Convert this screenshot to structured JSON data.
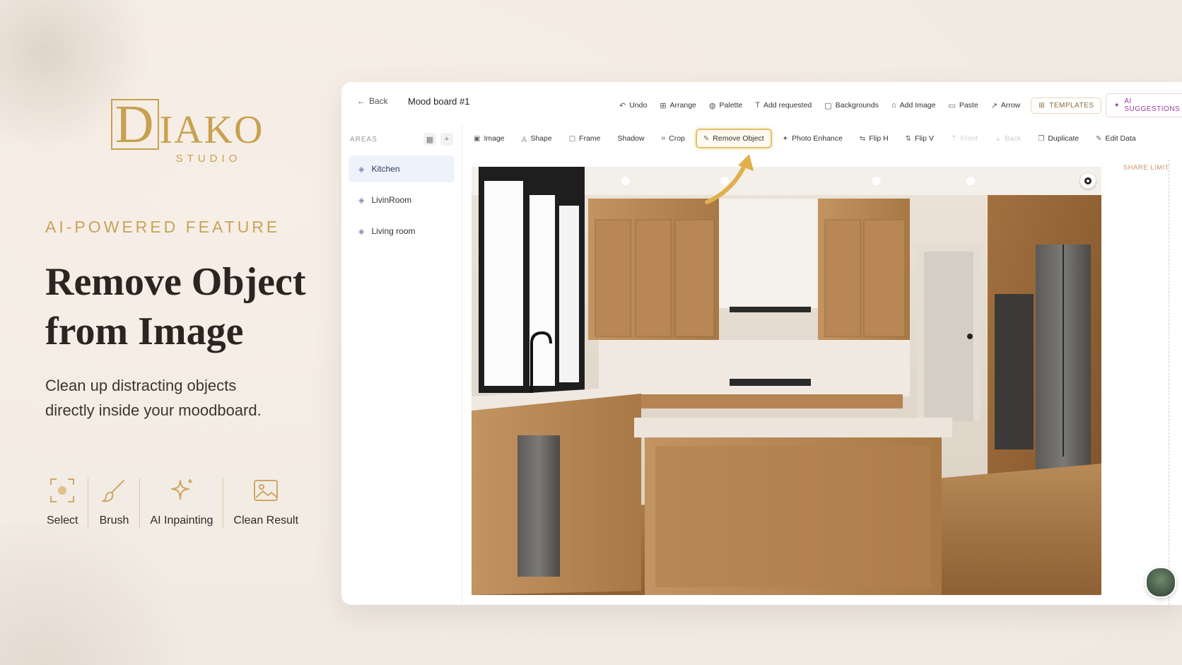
{
  "brand": {
    "name": "IAKO",
    "initial": "D",
    "sub": "STUDIO"
  },
  "hero": {
    "tag": "AI-POWERED FEATURE",
    "title_line1": "Remove Object",
    "title_line2": "from Image",
    "desc_line1": "Clean up distracting objects",
    "desc_line2": "directly inside your moodboard."
  },
  "steps": [
    {
      "label": "Select",
      "icon": "select-icon"
    },
    {
      "label": "Brush",
      "icon": "brush-icon"
    },
    {
      "label": "AI Inpainting",
      "icon": "sparkle-icon"
    },
    {
      "label": "Clean Result",
      "icon": "image-icon"
    }
  ],
  "app": {
    "back_label": "Back",
    "board_title": "Mood board #1",
    "top_actions": [
      {
        "label": "Undo",
        "glyph": "↶"
      },
      {
        "label": "Arrange",
        "glyph": "⊞"
      },
      {
        "label": "Palette",
        "glyph": "◍"
      },
      {
        "label": "Add requested",
        "glyph": "T"
      },
      {
        "label": "Backgrounds",
        "glyph": "▢"
      },
      {
        "label": "Add Image",
        "glyph": "⌂"
      },
      {
        "label": "Paste",
        "glyph": "▭"
      },
      {
        "label": "Arrow",
        "glyph": "↗"
      }
    ],
    "templates_label": "TEMPLATES",
    "ai_label": "AI SUGGESTIONS",
    "areas_title": "AREAS",
    "areas": [
      "Kitchen",
      "LivinRoom",
      "Living room"
    ],
    "toolbar": [
      {
        "label": "Image",
        "glyph": "▣"
      },
      {
        "label": "Shape",
        "glyph": "◬"
      },
      {
        "label": "Frame",
        "glyph": "▢"
      },
      {
        "label": "Shadow",
        "glyph": ""
      },
      {
        "label": "Crop",
        "glyph": "⌗"
      },
      {
        "label": "Remove Object",
        "glyph": "✎",
        "highlight": true
      },
      {
        "label": "Photo Enhance",
        "glyph": "✦"
      },
      {
        "label": "Flip H",
        "glyph": "⇆"
      },
      {
        "label": "Flip V",
        "glyph": "⇅"
      },
      {
        "label": "Front",
        "glyph": "⇡",
        "disabled": true
      },
      {
        "label": "Back",
        "glyph": "⇣",
        "disabled": true
      },
      {
        "label": "Duplicate",
        "glyph": "❐"
      },
      {
        "label": "Edit Data",
        "glyph": "✎"
      }
    ],
    "share_limit": "SHARE LIMIT"
  },
  "colors": {
    "gold": "#c7a14f",
    "highlight": "#e6c06a",
    "accent_ai": "#9b3d98"
  }
}
